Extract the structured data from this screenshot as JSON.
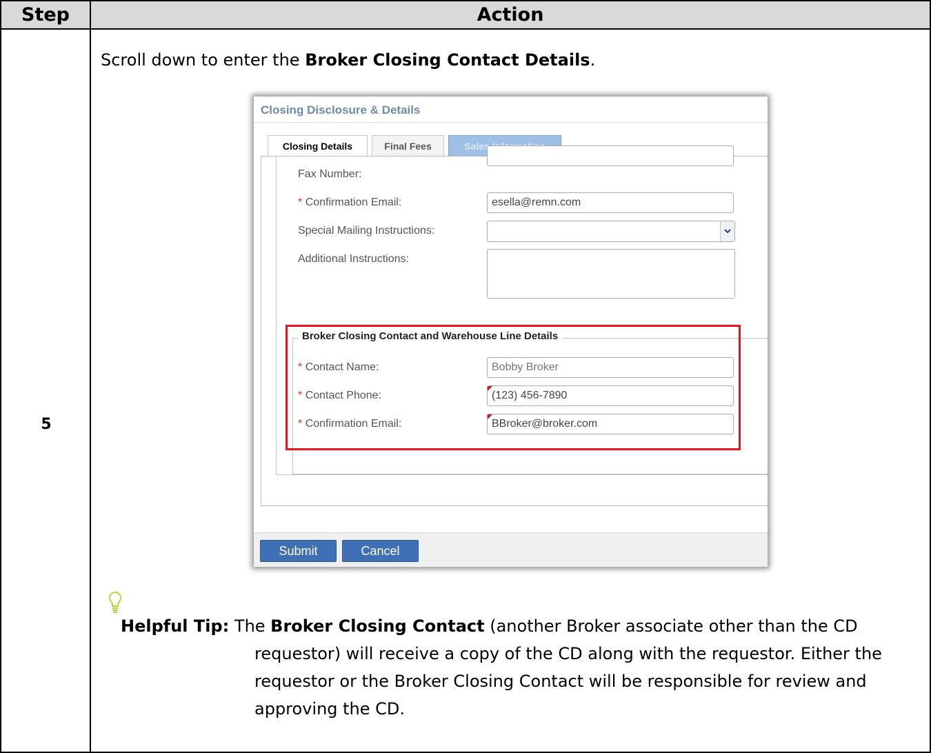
{
  "table": {
    "step_header": "Step",
    "action_header": "Action",
    "step_number": "5"
  },
  "instruction": {
    "prefix": "Scroll down to enter the ",
    "bold": "Broker Closing Contact Details",
    "suffix": "."
  },
  "screenshot": {
    "title": "Closing Disclosure & Details",
    "tabs": [
      "Closing Details",
      "Final Fees",
      "Sales Information"
    ],
    "fields": {
      "fax_label": "Fax Number:",
      "fax_value": "",
      "confirm_email_label": "Confirmation Email:",
      "confirm_email_value": "esella@remn.com",
      "special_mailing_label": "Special Mailing Instructions:",
      "special_mailing_value": "",
      "additional_label": "Additional Instructions:"
    },
    "broker_section": {
      "legend": "Broker Closing Contact and Warehouse Line Details",
      "contact_name_label": "Contact Name:",
      "contact_name_value": "Bobby Broker",
      "contact_phone_label": "Contact Phone:",
      "contact_phone_value": "(123) 456-7890",
      "confirm_email_label": "Confirmation Email:",
      "confirm_email_value": "BBroker@broker.com"
    },
    "required_marker": "*",
    "buttons": {
      "submit": "Submit",
      "cancel": "Cancel"
    }
  },
  "tip": {
    "label": "Helpful Tip:",
    "line1_prefix": "The ",
    "line1_bold": "Broker Closing Contact",
    "line1_rest": " (another Broker associate other than the CD",
    "continuation": "requestor) will receive a copy of the CD along with the requestor. Either the requestor or the Broker Closing Contact will be responsible for review and approving the CD."
  },
  "colors": {
    "header_bg": "#d9d9d9",
    "highlight_border": "#e8141b",
    "button_blue": "#3f6fb5",
    "title_blue": "#6e8ca8"
  },
  "icons": [
    "lightbulb-icon",
    "dropdown-arrow-icon"
  ]
}
